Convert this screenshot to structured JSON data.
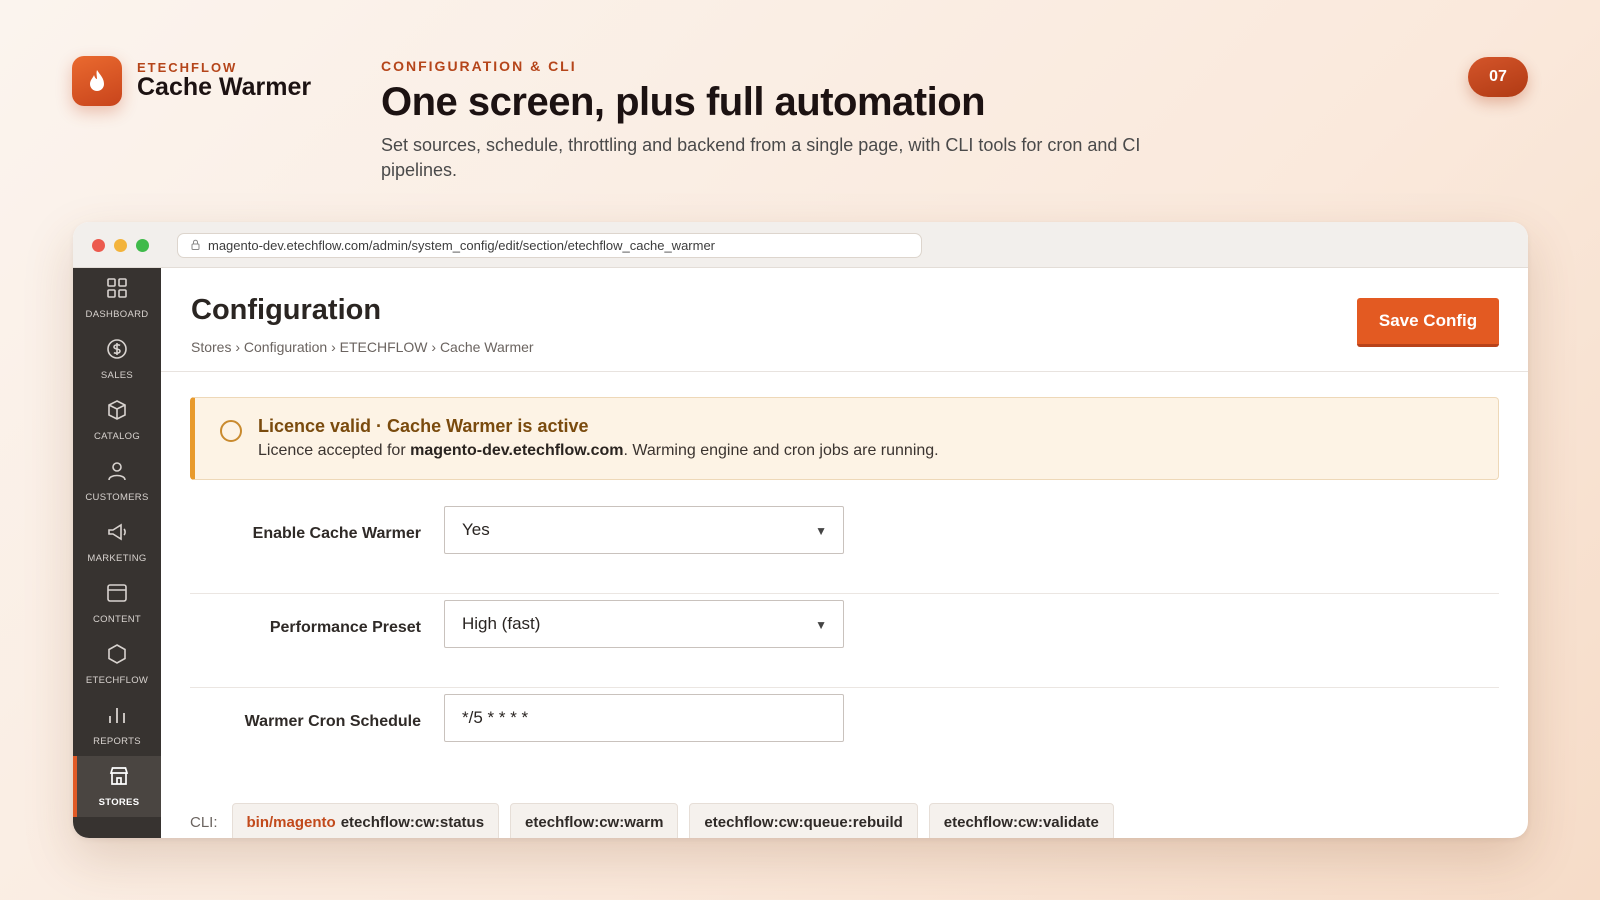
{
  "brand": {
    "kicker": "ETECHFLOW",
    "name": "Cache Warmer",
    "logo_icon": "flame-icon"
  },
  "hero": {
    "kicker": "CONFIGURATION & CLI",
    "title": "One screen, plus full automation",
    "subtitle": "Set sources, schedule, throttling and backend from a single page, with CLI tools for cron and CI pipelines."
  },
  "page_badge": "07",
  "browser": {
    "url": "magento-dev.etechflow.com/admin/system_config/edit/section/etechflow_cache_warmer"
  },
  "sidebar": {
    "items": [
      {
        "label": "DASHBOARD",
        "icon": "dashboard-grid-icon"
      },
      {
        "label": "SALES",
        "icon": "dollar-icon"
      },
      {
        "label": "CATALOG",
        "icon": "box-icon"
      },
      {
        "label": "CUSTOMERS",
        "icon": "person-icon"
      },
      {
        "label": "MARKETING",
        "icon": "megaphone-icon"
      },
      {
        "label": "CONTENT",
        "icon": "layout-icon"
      },
      {
        "label": "ETECHFLOW",
        "icon": "hexagon-icon"
      },
      {
        "label": "REPORTS",
        "icon": "bar-chart-icon"
      },
      {
        "label": "STORES",
        "icon": "store-icon",
        "active": true
      }
    ]
  },
  "header": {
    "title": "Configuration",
    "breadcrumb": "Stores › Configuration › ETECHFLOW › Cache Warmer",
    "save_label": "Save Config"
  },
  "notice": {
    "title": "Licence valid · Cache Warmer is active",
    "text_before": "Licence accepted for ",
    "domain": "magento-dev.etechflow.com",
    "text_after": ". Warming engine and cron jobs are running."
  },
  "fields": [
    {
      "label": "Enable Cache Warmer",
      "value": "Yes",
      "type": "select"
    },
    {
      "label": "Performance Preset",
      "value": "High (fast)",
      "type": "select"
    },
    {
      "label": "Warmer Cron Schedule",
      "value": "*/5 * * * *",
      "type": "text"
    }
  ],
  "cli": {
    "label": "CLI:",
    "bin_prefix": "bin/magento",
    "commands": [
      "etechflow:cw:status",
      "etechflow:cw:warm",
      "etechflow:cw:queue:rebuild",
      "etechflow:cw:validate"
    ]
  },
  "colors": {
    "accent": "#e35a22",
    "sidebar_bg": "#373330",
    "notice_border": "#e89a2c"
  }
}
